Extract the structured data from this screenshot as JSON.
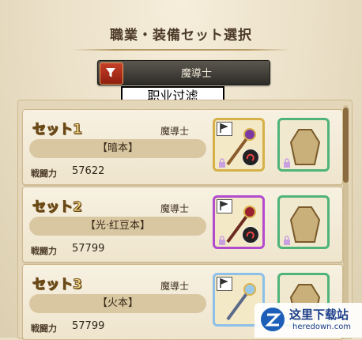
{
  "header": {
    "title": "職業・装備セット選択"
  },
  "filter": {
    "job": "魔導士",
    "overlay_label": "职业过滤"
  },
  "sets": [
    {
      "name": "セット1",
      "job": "魔導士",
      "tag": "【暗本】",
      "power_label": "戦闘力",
      "power": "57622"
    },
    {
      "name": "セット2",
      "job": "魔導士",
      "tag": "【光·红豆本】",
      "power_label": "戦闘力",
      "power": "57799"
    },
    {
      "name": "セット3",
      "job": "魔導士",
      "tag": "【火本】",
      "power_label": "戦闘力",
      "power": "57799"
    }
  ],
  "watermark": {
    "text": "这里下载站",
    "url": "heredown.com"
  },
  "colors": {
    "background": "#eadfc6",
    "filter_button": "#c64027",
    "weapon_frame": "#d6b14a",
    "armor_frame": "#4fb37a"
  }
}
